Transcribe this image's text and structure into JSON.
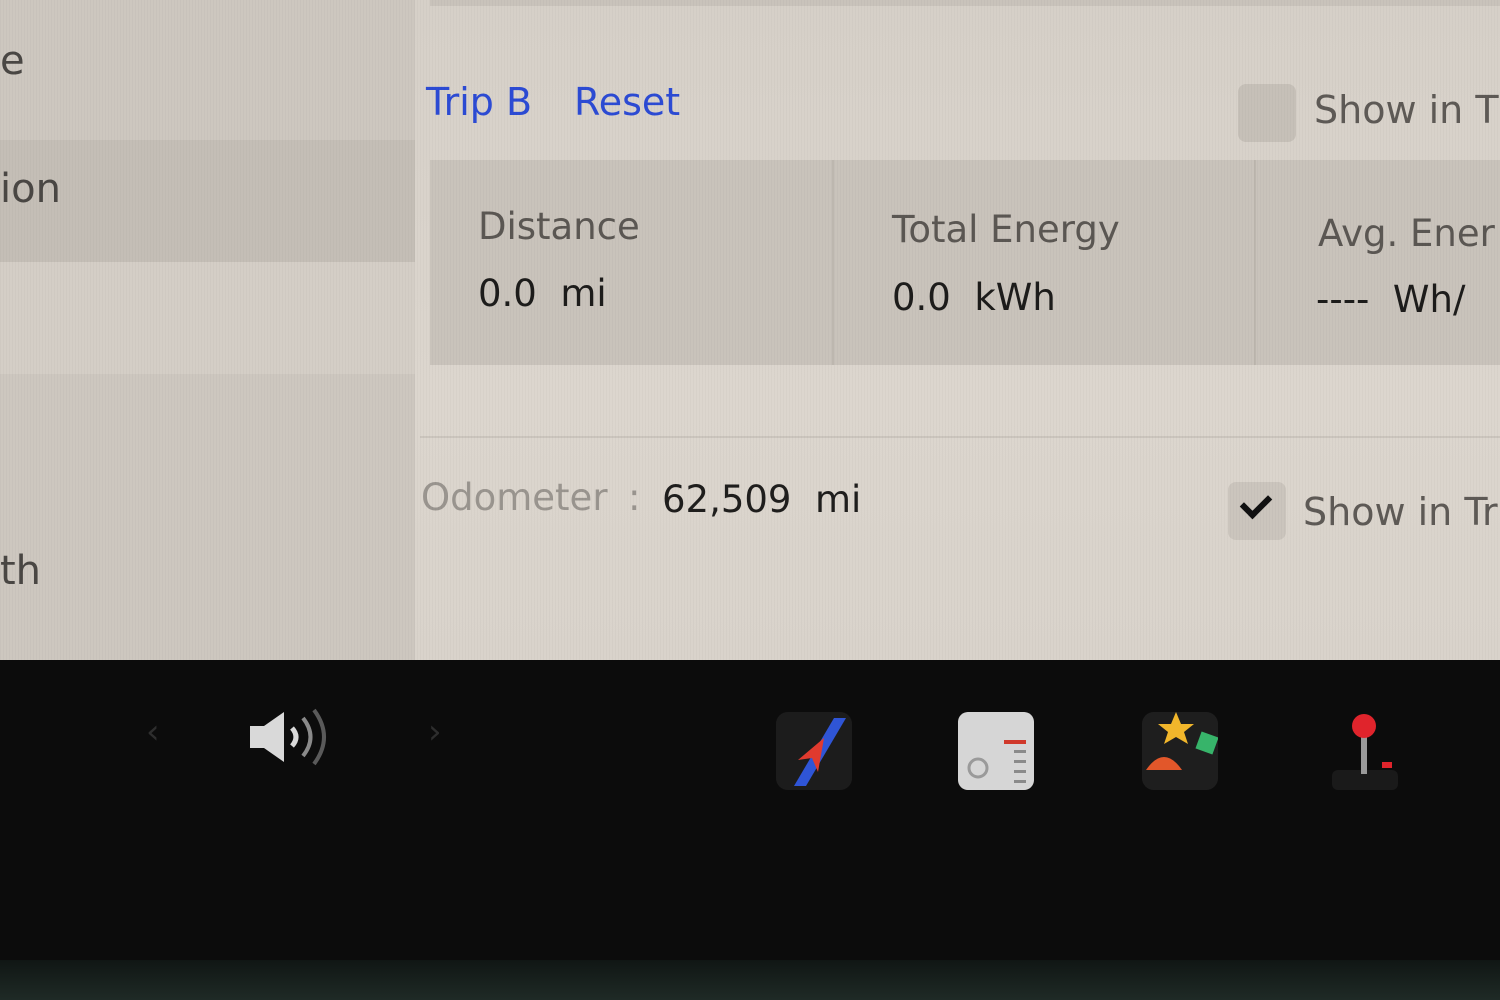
{
  "sidebar": {
    "items": [
      {
        "label": "e"
      },
      {
        "label": "ion"
      },
      {
        "label": "th"
      }
    ]
  },
  "trip": {
    "title": "Trip B",
    "reset_label": "Reset",
    "show_in_label": "Show in T",
    "show_in_checked": false,
    "stats": [
      {
        "label": "Distance",
        "value": "0.0  mi"
      },
      {
        "label": "Total Energy",
        "value": "0.0  kWh"
      },
      {
        "label": "Avg. Ener",
        "value": "----  Wh/"
      }
    ]
  },
  "odometer": {
    "label": "Odometer",
    "separator": ":",
    "value": "62,509  mi",
    "show_in_label": "Show in Tr",
    "show_in_checked": true
  },
  "taskbar": {
    "prev_icon": "chevron-left-icon",
    "next_icon": "chevron-right-icon",
    "prev_glyph": "‹",
    "next_glyph": "›",
    "volume_icon": "speaker-icon",
    "apps": [
      {
        "name": "navigation-app-icon"
      },
      {
        "name": "dashcam-app-icon"
      },
      {
        "name": "toybox-app-icon"
      },
      {
        "name": "arcade-app-icon"
      }
    ]
  },
  "colors": {
    "link": "#2c4bd4",
    "screen_bg": "#d6d0c8",
    "taskbar_bg": "#0c0c0c"
  }
}
